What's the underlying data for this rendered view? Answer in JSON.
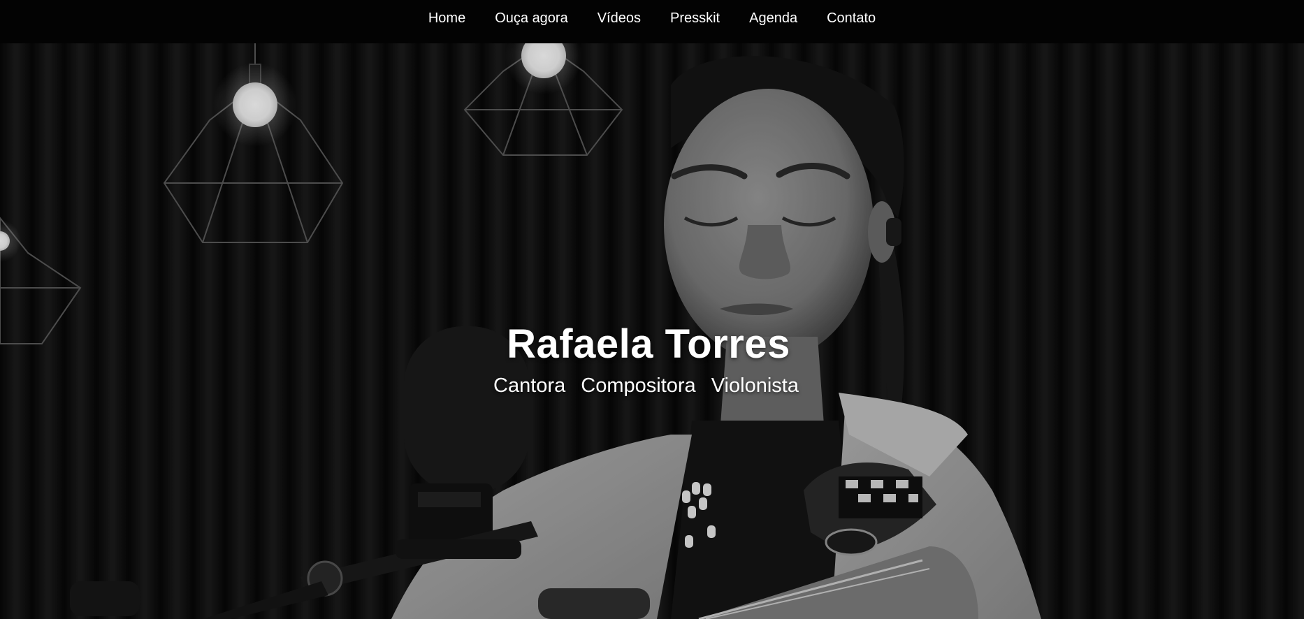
{
  "nav": {
    "items": [
      {
        "label": "Home"
      },
      {
        "label": "Ouça agora"
      },
      {
        "label": "Vídeos"
      },
      {
        "label": "Presskit"
      },
      {
        "label": "Agenda"
      },
      {
        "label": "Contato"
      }
    ]
  },
  "hero": {
    "title": "Rafaela Torres",
    "roles": [
      "Cantora",
      "Compositora",
      "Violonista"
    ]
  },
  "colors": {
    "nav_background": "#030303",
    "text": "#ffffff",
    "hero_tint": "grayscale"
  }
}
